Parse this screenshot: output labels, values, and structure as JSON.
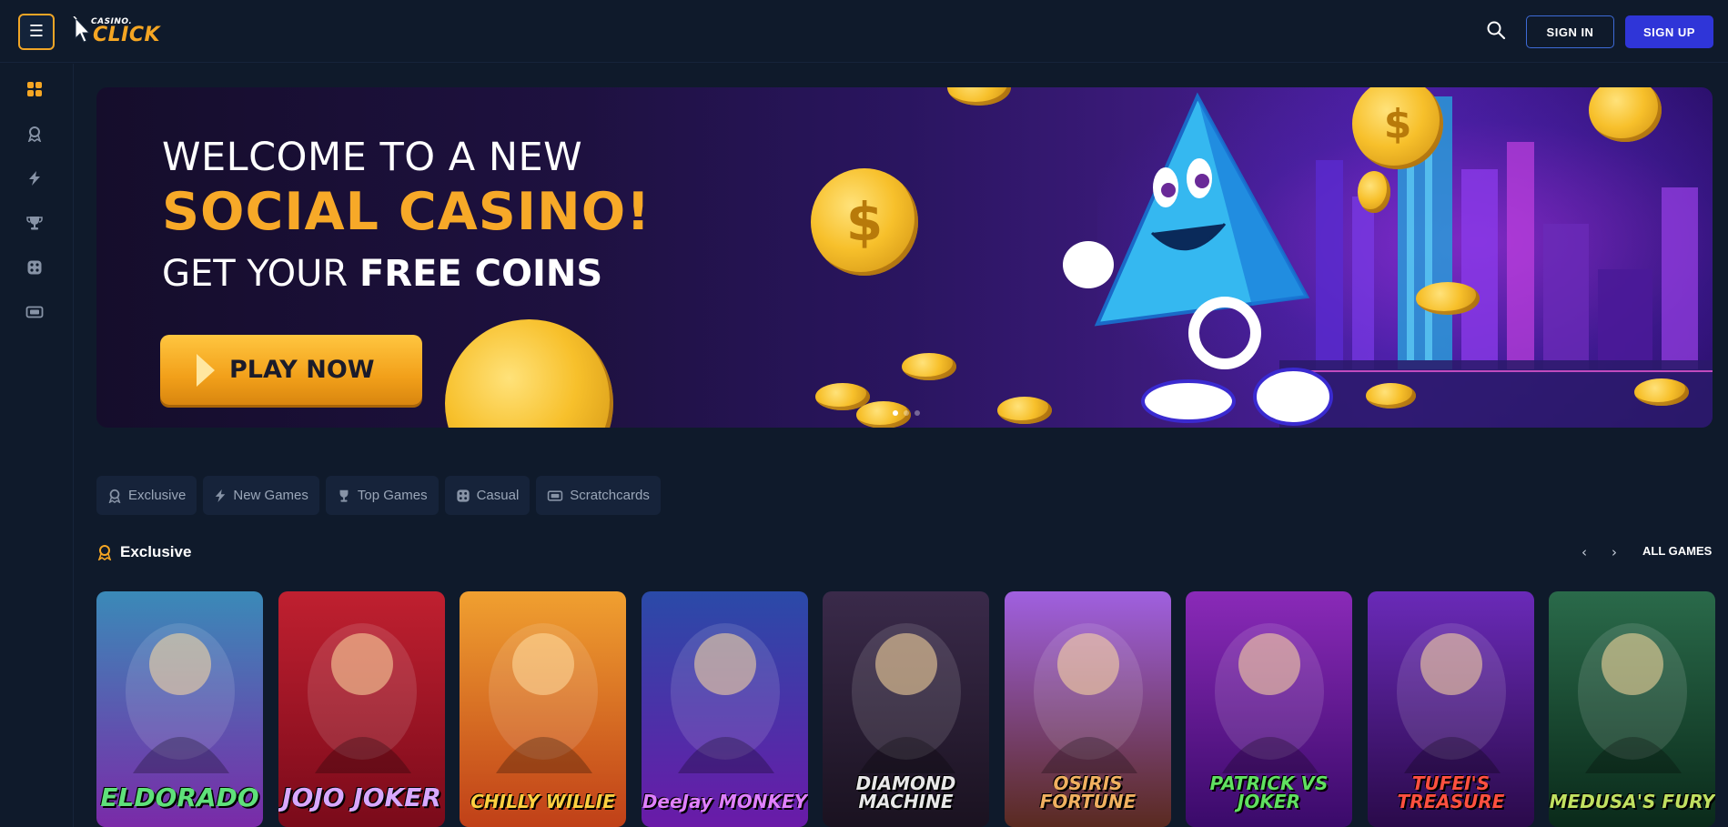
{
  "header": {
    "logo_small": "CASINO.",
    "logo_big": "CLICK",
    "signin_label": "SIGN IN",
    "signup_label": "SIGN UP"
  },
  "sidebar": {
    "items": [
      {
        "icon": "grid-icon",
        "active": true
      },
      {
        "icon": "exclusive-icon"
      },
      {
        "icon": "lightning-icon"
      },
      {
        "icon": "trophy-icon"
      },
      {
        "icon": "dice-icon"
      },
      {
        "icon": "ticket-icon"
      }
    ]
  },
  "hero": {
    "line1": "WELCOME TO A NEW",
    "line2": "SOCIAL CASINO!",
    "line3_prefix": "GET YOUR ",
    "line3_bold": "FREE COINS",
    "cta": "PLAY NOW"
  },
  "tabs": [
    {
      "label": "Exclusive",
      "icon": "exclusive-icon"
    },
    {
      "label": "New Games",
      "icon": "lightning-icon"
    },
    {
      "label": "Top Games",
      "icon": "trophy-icon"
    },
    {
      "label": "Casual",
      "icon": "dice-icon"
    },
    {
      "label": "Scratchcards",
      "icon": "ticket-icon"
    }
  ],
  "section": {
    "title": "Exclusive",
    "all_games": "ALL GAMES"
  },
  "games": [
    {
      "title": "ELDORADO",
      "bg1": "#3a8ab8",
      "bg2": "#7a2aa8",
      "color": "#5fe07a"
    },
    {
      "title": "JOJO JOKER",
      "bg1": "#c02030",
      "bg2": "#7a0a1a",
      "color": "#d8a8ff"
    },
    {
      "title": "CHILLY WILLIE",
      "bg1": "#f0a030",
      "bg2": "#c04018",
      "color": "#ffd040"
    },
    {
      "title": "DeeJay MONKEY",
      "bg1": "#2a4aa8",
      "bg2": "#6a1aa8",
      "color": "#e080ff"
    },
    {
      "title": "DIAMOND MACHINE",
      "bg1": "#3a2a4a",
      "bg2": "#1a1220",
      "color": "#e8e8e8"
    },
    {
      "title": "OSIRIS FORTUNE",
      "bg1": "#a060e0",
      "bg2": "#5a2a20",
      "color": "#f0b060"
    },
    {
      "title": "PATRICK VS JOKER",
      "bg1": "#8a2ab8",
      "bg2": "#3a0a6a",
      "color": "#60e060"
    },
    {
      "title": "TUFEI'S TREASURE",
      "bg1": "#6a2ab8",
      "bg2": "#2a0a4a",
      "color": "#ff5040"
    },
    {
      "title": "MEDUSA'S FURY",
      "bg1": "#2a6a4a",
      "bg2": "#0a2a1a",
      "color": "#c0e060"
    }
  ]
}
